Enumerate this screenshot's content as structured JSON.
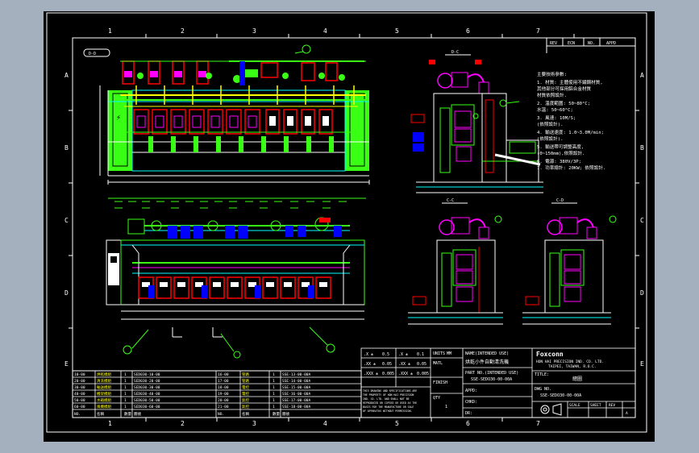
{
  "grid": {
    "columns": [
      "1",
      "2",
      "3",
      "4",
      "5",
      "6",
      "7"
    ],
    "rows": [
      "A",
      "B",
      "C",
      "D",
      "E"
    ]
  },
  "revision_header": [
    "REV",
    "ECN",
    "NO.",
    "APPD"
  ],
  "section_labels": {
    "top_view": "D-D",
    "side_top": "D-C",
    "side_bottom_left": "C-C",
    "side_bottom_right": "C-D"
  },
  "tech_notes": {
    "heading": "主要技術參數:",
    "lines": [
      "1. 材質: 主體使用不鏽鋼材質,",
      "   其他部分可採用鋁合金材質",
      "   材質依照設計.",
      "2. 溫度範圍: 50~80°C;",
      "   水溫: 50~60°C;",
      "3. 風速: 10M/S;",
      "   (依照設計).",
      "4. 輸送速度: 1.0~3.0M/min;",
      "   (依照設計).",
      "5. 輸送帶可調整高度,",
      "   (0~150mm),依照設計.",
      "6. 電源: 380V/3P;",
      "7. 功率總計: 20KW; 依照設計."
    ]
  },
  "title_block": {
    "tolerance_rows": [
      [
        ".X ±",
        "0.5",
        ".X ±",
        "0.1"
      ],
      [
        ".XX ±",
        "0.05",
        ".XX ±",
        "0.05"
      ],
      [
        ".XXX ±",
        "0.005",
        ".XXX ±",
        "0.005"
      ]
    ],
    "units_label": "UNITS",
    "units_value": "MM",
    "matl_label": "MATL",
    "finish_label": "FINISH",
    "qty_label": "QTY",
    "qty_value": "1",
    "name_header": "NAME(INTENDED USE)",
    "name_value": "烘乾小件自動清洗機",
    "part_no_label": "PART NO.(INTENDED USE)",
    "part_no_value": "SSE-SEDO30-00-00A",
    "appd_label": "APPD:",
    "chkd_label": "CHKD:",
    "dr_label": "DR:",
    "company_logo": "Foxconn",
    "company_line1": "HON HAI PRECISION IND. CO. LTD.",
    "company_line2": "TAIPEI, TAIWAN, R.O.C.",
    "title_label": "TITLE:",
    "title_value": "總圖",
    "dwg_label": "DWG NO.",
    "dwg_value": "SSE-SEDO30-00-00A",
    "scale_label": "SCALE",
    "sheet_label": "SHEET",
    "rev_label": "REV",
    "rev_value": "A",
    "disclaimer_lines": [
      "THIS DRAWING AND SPECIFICATIONS ARE",
      "THE PROPERTY OF HON HAI PRECISION",
      "IND. CO. LTD. AND SHALL NOT BE",
      "REPRODUCED OR COPIED OR USED AS THE",
      "BASIS FOR THE MANUFACTURE OR SALE",
      "OF APPARATUS WITHOUT PERMISSION."
    ]
  },
  "bom": {
    "rows": [
      [
        "10-00",
        "烘乾模組",
        "1",
        "SED030-10-00",
        "16-00",
        "管路",
        "1",
        "SSE-13-00-00A"
      ],
      [
        "20-00",
        "清洗模組",
        "1",
        "SED030-20-00",
        "17-00",
        "管路",
        "1",
        "SSE-14-00-00A"
      ],
      [
        "30-00",
        "輸送模組",
        "1",
        "SED030-30-00",
        "18-00",
        "電控",
        "1",
        "SSE-15-00-00A"
      ],
      [
        "40-00",
        "機架模組",
        "1",
        "SED030-40-00",
        "19-00",
        "電控",
        "1",
        "SSE-16-00-00A"
      ],
      [
        "50-00",
        "水箱模組",
        "1",
        "SED030-50-00",
        "20-00",
        "氣控",
        "1",
        "SSE-17-00-00A"
      ],
      [
        "60-00",
        "風機模組",
        "1",
        "SED030-60-00",
        "21-00",
        "氣控",
        "1",
        "SSE-18-00-00A"
      ]
    ],
    "header": [
      "NO.",
      "名稱",
      "數量",
      "圖號",
      "NO.",
      "名稱",
      "數量",
      "圖號"
    ]
  }
}
